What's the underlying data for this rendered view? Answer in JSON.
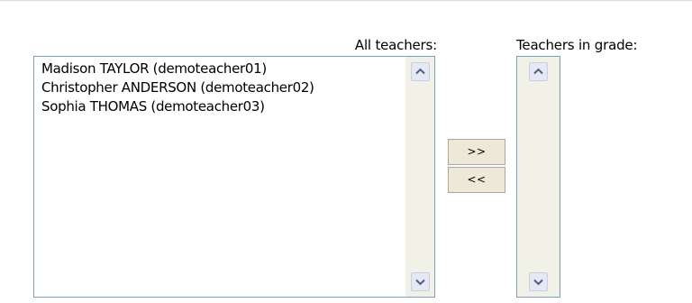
{
  "labels": {
    "all_teachers": "All teachers:",
    "teachers_in_grade": "Teachers in grade:"
  },
  "all_teachers_list": {
    "items": [
      "Madison TAYLOR (demoteacher01)",
      "Christopher ANDERSON (demoteacher02)",
      "Sophia THOMAS (demoteacher03)"
    ]
  },
  "teachers_in_grade_list": {
    "items": []
  },
  "buttons": {
    "add": ">>",
    "remove": "<<"
  },
  "icons": {
    "scroll_up": "chevron-up-icon",
    "scroll_down": "chevron-down-icon"
  },
  "colors": {
    "listbox_border": "#7f9db9",
    "scroll_track": "#f2f1e8",
    "button_face": "#ece9d8"
  }
}
